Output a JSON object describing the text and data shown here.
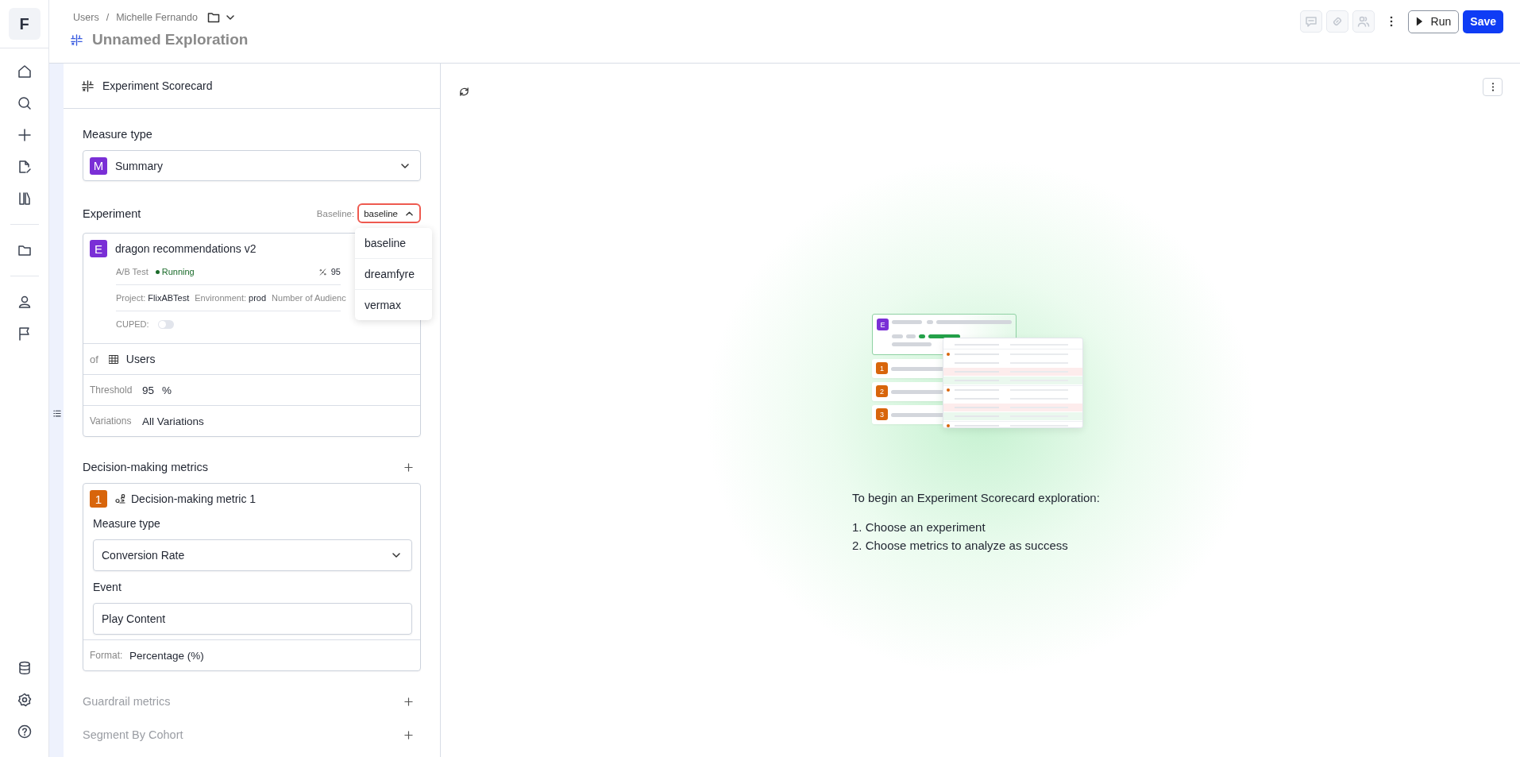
{
  "nav": {
    "logo": "F"
  },
  "breadcrumb": {
    "items": [
      "Users",
      "Michelle Fernando"
    ],
    "separator": "/"
  },
  "title": "Unnamed Exploration",
  "header_actions": {
    "run": "Run",
    "save": "Save"
  },
  "panel": {
    "title": "Experiment Scorecard",
    "measure_type": {
      "label": "Measure type",
      "badge": "M",
      "value": "Summary"
    },
    "experiment": {
      "label": "Experiment",
      "baseline_label": "Baseline:",
      "baseline_value": "baseline",
      "baseline_expanded": true,
      "baseline_options": [
        "baseline",
        "dreamfyre",
        "vermax"
      ],
      "badge": "E",
      "name": "dragon recommendations v2",
      "type": "A/B Test",
      "status": "Running",
      "confidence": "95",
      "project_label": "Project:",
      "project": "FlixABTest",
      "environment_label": "Environment:",
      "environment": "prod",
      "audiences_label": "Number of Audienc",
      "cuped_label": "CUPED:",
      "cuped_on": false,
      "of_label": "of",
      "entity": "Users",
      "threshold_label": "Threshold",
      "threshold": "95",
      "threshold_unit": "%",
      "variations_label": "Variations",
      "variations": "All Variations"
    },
    "metric_sections": [
      {
        "label": "Decision-making metrics",
        "disabled": false,
        "items": [
          {
            "badge": "1",
            "name": "Decision-making metric 1",
            "measure_type_label": "Measure type",
            "measure_type": "Conversion Rate",
            "event_label": "Event",
            "event": "Play Content",
            "format_label": "Format:",
            "format": "Percentage (%)"
          }
        ]
      },
      {
        "label": "Guardrail metrics",
        "disabled": true
      },
      {
        "label": "Segment By Cohort",
        "disabled": true
      }
    ]
  },
  "empty_state": {
    "illustration_badges": [
      "E",
      "1",
      "2",
      "3"
    ],
    "heading": "To begin an Experiment Scorecard exploration:",
    "steps": [
      "1. Choose an experiment",
      "2. Choose metrics to analyze as success"
    ]
  }
}
